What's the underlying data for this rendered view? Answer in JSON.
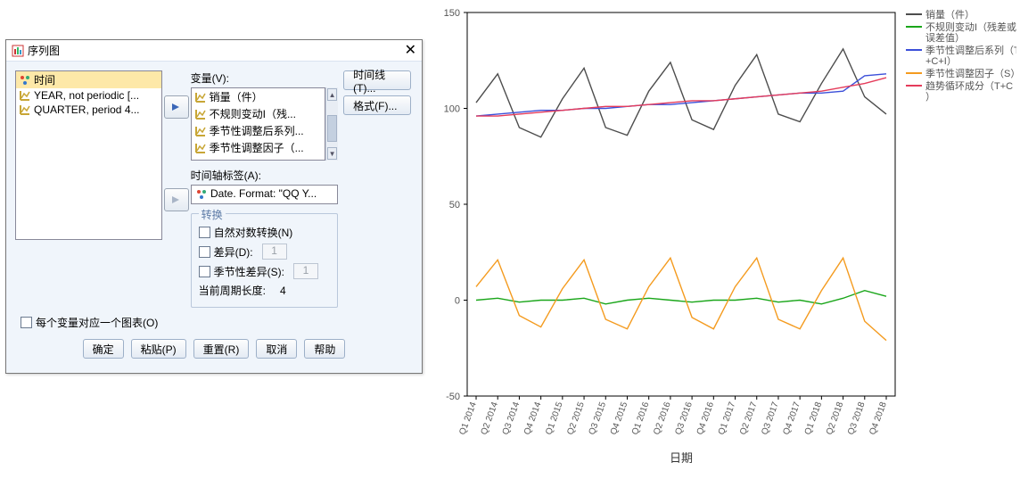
{
  "dialog": {
    "title": "序列图",
    "left_list": {
      "items": [
        {
          "label": "时间",
          "sel": true,
          "icon": "nominal"
        },
        {
          "label": "YEAR, not periodic [...",
          "icon": "scale"
        },
        {
          "label": "QUARTER, period 4...",
          "icon": "scale"
        }
      ]
    },
    "vars_label": "变量(V):",
    "var_list": {
      "items": [
        {
          "label": "销量（件）",
          "icon": "scale"
        },
        {
          "label": "不规则变动I（残...",
          "icon": "scale"
        },
        {
          "label": "季节性调整后系列...",
          "icon": "scale"
        },
        {
          "label": "季节性调整因子（...",
          "icon": "scale"
        }
      ]
    },
    "axis_label": "时间轴标签(A):",
    "axis_value": "Date.  Format:  \"QQ Y...",
    "transform": {
      "legend": "转换",
      "log": "自然对数转换(N)",
      "diff": "差异(D):",
      "diff_val": "1",
      "sdiff": "季节性差异(S):",
      "sdiff_val": "1",
      "period": "当前周期长度:",
      "period_val": "4"
    },
    "side_buttons": {
      "timelines": "时间线(T)...",
      "format": "格式(F)..."
    },
    "one_per_var": "每个变量对应一个图表(O)",
    "buttons": {
      "ok": "确定",
      "paste": "粘贴(P)",
      "reset": "重置(R)",
      "cancel": "取消",
      "help": "帮助"
    }
  },
  "chart": {
    "xlabel": "日期",
    "legend": [
      {
        "label": "销量（件）",
        "color": "#4d4d4d"
      },
      {
        "label": "不规则变动I（残差或误差值）",
        "color": "#1aa61a"
      },
      {
        "label": "季节性调整后系列（T+C+I）",
        "color": "#3b4fd9"
      },
      {
        "label": "季节性调整因子（S）",
        "color": "#f49b1f"
      },
      {
        "label": "趋势循环成分（T+C）",
        "color": "#e53c5b"
      }
    ]
  },
  "chart_data": {
    "type": "line",
    "categories": [
      "Q1 2014",
      "Q2 2014",
      "Q3 2014",
      "Q4 2014",
      "Q1 2015",
      "Q2 2015",
      "Q3 2015",
      "Q4 2015",
      "Q1 2016",
      "Q2 2016",
      "Q3 2016",
      "Q4 2016",
      "Q1 2017",
      "Q2 2017",
      "Q3 2017",
      "Q4 2017",
      "Q1 2018",
      "Q2 2018",
      "Q3 2018",
      "Q4 2018"
    ],
    "ylim": [
      -50,
      150
    ],
    "yticks": [
      -50,
      0,
      50,
      100,
      150
    ],
    "series": [
      {
        "name": "销量（件）",
        "color": "#4d4d4d",
        "values": [
          103,
          118,
          90,
          85,
          105,
          121,
          90,
          86,
          109,
          124,
          94,
          89,
          112,
          128,
          97,
          93,
          113,
          131,
          106,
          97
        ]
      },
      {
        "name": "不规则变动I（残差或误差值）",
        "color": "#1aa61a",
        "values": [
          0,
          1,
          -1,
          0,
          0,
          1,
          -2,
          0,
          1,
          0,
          -1,
          0,
          0,
          1,
          -1,
          0,
          -2,
          1,
          5,
          2
        ]
      },
      {
        "name": "季节性调整后系列（T+C+I）",
        "color": "#3b4fd9",
        "values": [
          96,
          97,
          98,
          99,
          99,
          100,
          100,
          101,
          102,
          102,
          103,
          104,
          105,
          106,
          107,
          108,
          108,
          109,
          117,
          118
        ]
      },
      {
        "name": "季节性调整因子（S）",
        "color": "#f49b1f",
        "values": [
          7,
          21,
          -8,
          -14,
          6,
          21,
          -10,
          -15,
          7,
          22,
          -9,
          -15,
          7,
          22,
          -10,
          -15,
          5,
          22,
          -11,
          -21
        ]
      },
      {
        "name": "趋势循环成分（T+C）",
        "color": "#e53c5b",
        "values": [
          96,
          96,
          97,
          98,
          99,
          100,
          101,
          101,
          102,
          103,
          104,
          104,
          105,
          106,
          107,
          108,
          109,
          111,
          113,
          116
        ]
      }
    ]
  }
}
